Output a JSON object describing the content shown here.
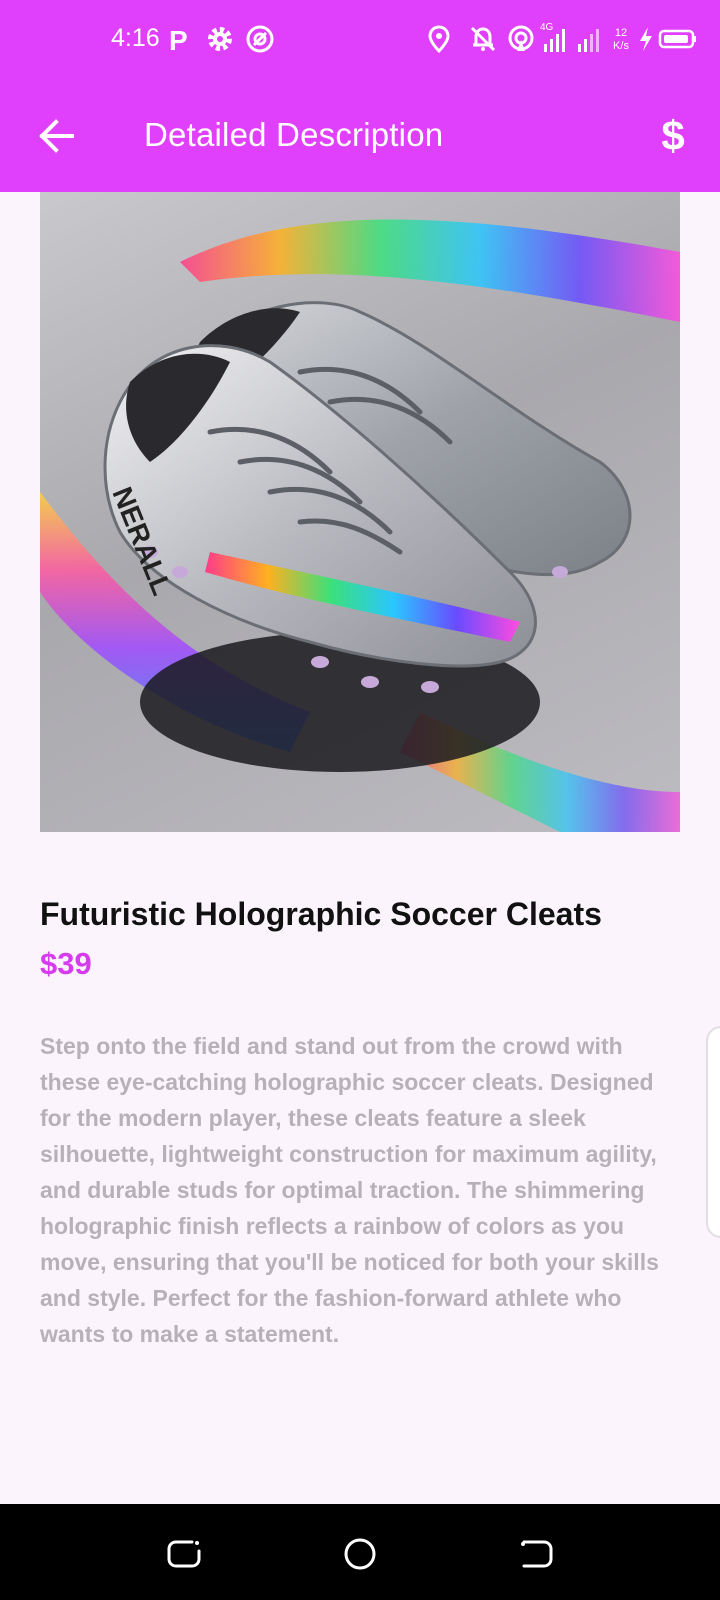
{
  "status_bar": {
    "time": "4:16",
    "network_type": "4G",
    "speed_value": "12",
    "speed_unit": "K/s",
    "icons": [
      "parking-icon",
      "gear-icon",
      "at-sign-icon",
      "location-icon",
      "bell-off-icon",
      "hotspot-icon",
      "signal-icon",
      "signal-weak-icon",
      "charging-icon",
      "battery-icon"
    ]
  },
  "header": {
    "title": "Detailed Description",
    "action_label": "$",
    "background_color": "#e040fb"
  },
  "product": {
    "title": "Futuristic Holographic Soccer Cleats",
    "price": "$39",
    "image_brand_text": "NERALL",
    "description": "Step onto the field and stand out from the crowd with these eye-catching holographic soccer cleats. Designed for the modern player, these cleats feature a sleek silhouette, lightweight construction for maximum agility, and durable studs for optimal traction. The shimmering holographic finish reflects a rainbow of colors as you move, ensuring that you'll be noticed for both your skills and style. Perfect for the fashion-forward athlete who wants to make a statement."
  },
  "colors": {
    "accent": "#e040fb",
    "price": "#d63bf0",
    "description_text": "#b6b1b8",
    "page_background": "#fcf4fc"
  },
  "nav": {
    "items": [
      "recents-icon",
      "home-icon",
      "back-nav-icon"
    ]
  }
}
